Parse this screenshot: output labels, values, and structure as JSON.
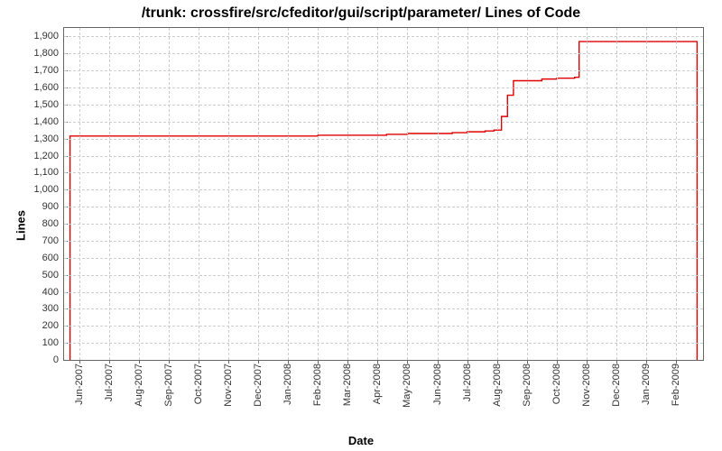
{
  "chart_data": {
    "type": "line",
    "title": "/trunk: crossfire/src/cfeditor/gui/script/parameter/ Lines of Code",
    "xlabel": "Date",
    "ylabel": "Lines",
    "ylim": [
      0,
      1950
    ],
    "y_ticks": [
      0,
      100,
      200,
      300,
      400,
      500,
      600,
      700,
      800,
      900,
      1000,
      1100,
      1200,
      1300,
      1400,
      1500,
      1600,
      1700,
      1800,
      1900
    ],
    "y_tick_labels": [
      "0",
      "100",
      "200",
      "300",
      "400",
      "500",
      "600",
      "700",
      "800",
      "900",
      "1,000",
      "1,100",
      "1,200",
      "1,300",
      "1,400",
      "1,500",
      "1,600",
      "1,700",
      "1,800",
      "1,900"
    ],
    "x_ticks": [
      0,
      1,
      2,
      3,
      4,
      5,
      6,
      7,
      8,
      9,
      10,
      11,
      12,
      13,
      14,
      15,
      16,
      17,
      18,
      19,
      20
    ],
    "x_tick_labels": [
      "Jun-2007",
      "Jul-2007",
      "Aug-2007",
      "Sep-2007",
      "Oct-2007",
      "Nov-2007",
      "Dec-2007",
      "Jan-2008",
      "Feb-2008",
      "Mar-2008",
      "Apr-2008",
      "May-2008",
      "Jun-2008",
      "Jul-2008",
      "Aug-2008",
      "Sep-2008",
      "Oct-2008",
      "Nov-2008",
      "Dec-2008",
      "Jan-2009",
      "Feb-2009"
    ],
    "xlim": [
      -0.5,
      20.9
    ],
    "series": [
      {
        "name": "lines-of-code",
        "color": "#e00000",
        "x": [
          -0.3,
          -0.3,
          5.0,
          8.0,
          10.3,
          11.0,
          12.5,
          13.0,
          13.6,
          13.9,
          14.15,
          14.35,
          14.55,
          15.5,
          16.0,
          16.6,
          16.75,
          20.7,
          20.7
        ],
        "values": [
          0,
          1315,
          1315,
          1320,
          1325,
          1330,
          1335,
          1340,
          1345,
          1350,
          1430,
          1555,
          1640,
          1650,
          1655,
          1660,
          1870,
          1870,
          0
        ]
      }
    ]
  }
}
